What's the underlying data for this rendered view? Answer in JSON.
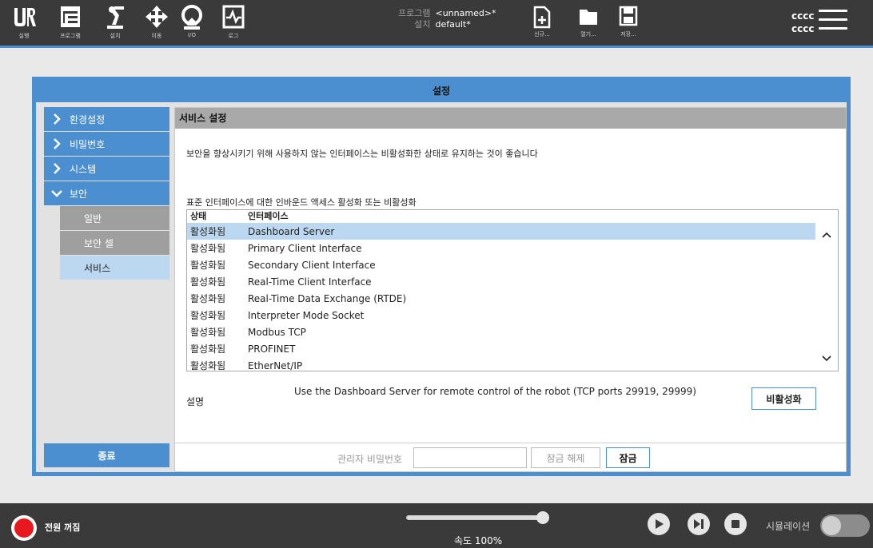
{
  "topbar": {
    "nav": [
      {
        "label": "실행",
        "icon": "ur-logo-icon"
      },
      {
        "label": "프로그램",
        "icon": "program-icon"
      },
      {
        "label": "설치",
        "icon": "robot-arm-icon"
      },
      {
        "label": "이동",
        "icon": "move-arrows-icon"
      },
      {
        "label": "I/O",
        "icon": "io-icon"
      },
      {
        "label": "로그",
        "icon": "log-icon"
      }
    ],
    "program_key": "프로그램",
    "program_value": "<unnamed>*",
    "install_key": "설치",
    "install_value": "default*",
    "file_buttons": [
      {
        "label": "신규...",
        "icon": "new-file-icon"
      },
      {
        "label": "열기...",
        "icon": "open-folder-icon"
      },
      {
        "label": "저장...",
        "icon": "save-icon"
      }
    ],
    "user_line1": "cccc",
    "user_line2": "cccc"
  },
  "dialog": {
    "title": "설정",
    "sidebar": {
      "items": [
        {
          "label": "환경설정"
        },
        {
          "label": "비밀번호"
        },
        {
          "label": "시스템"
        },
        {
          "label": "보안"
        }
      ],
      "sub_items": [
        {
          "label": "일반"
        },
        {
          "label": "보안 셀"
        },
        {
          "label": "서비스"
        }
      ],
      "exit_label": "종료"
    },
    "main": {
      "header": "서비스 설정",
      "description": "보안을 향상시키기 위해 사용하지 않는 인터페이스는 비활성화한 상태로 유지하는 것이 좋습니다",
      "subtitle": "표준 인터페이스에 대한 인바운드 액세스 활성화 또는 비활성화",
      "table": {
        "columns": [
          "상태",
          "인터페이스"
        ],
        "rows": [
          {
            "status": "활성화됨",
            "name": "Dashboard Server"
          },
          {
            "status": "활성화됨",
            "name": "Primary Client Interface"
          },
          {
            "status": "활성화됨",
            "name": "Secondary Client Interface"
          },
          {
            "status": "활성화됨",
            "name": "Real-Time Client Interface"
          },
          {
            "status": "활성화됨",
            "name": "Real-Time Data Exchange (RTDE)"
          },
          {
            "status": "활성화됨",
            "name": "Interpreter Mode Socket"
          },
          {
            "status": "활성화됨",
            "name": "Modbus TCP"
          },
          {
            "status": "활성화됨",
            "name": "PROFINET"
          },
          {
            "status": "활성화됨",
            "name": "EtherNet/IP"
          }
        ]
      },
      "desc_label": "설명",
      "desc_text": "Use the Dashboard Server for remote control of the robot (TCP ports 29919, 29999)",
      "disable_label": "비활성화",
      "admin_pw_label": "관리자 비밀번호",
      "unlock_label": "잠금 해제",
      "lock_label": "잠금"
    }
  },
  "footer": {
    "power_label": "전원 꺼짐",
    "speed_label": "속도 100%",
    "speed_fraction": 1.0,
    "simulation_label": "시뮬레이션",
    "simulation_on": false
  },
  "colors": {
    "accent": "#4b8fd0",
    "topbar": "#3a3a3a",
    "selected_row": "#bcd8f0",
    "power_red": "#e8191e"
  }
}
